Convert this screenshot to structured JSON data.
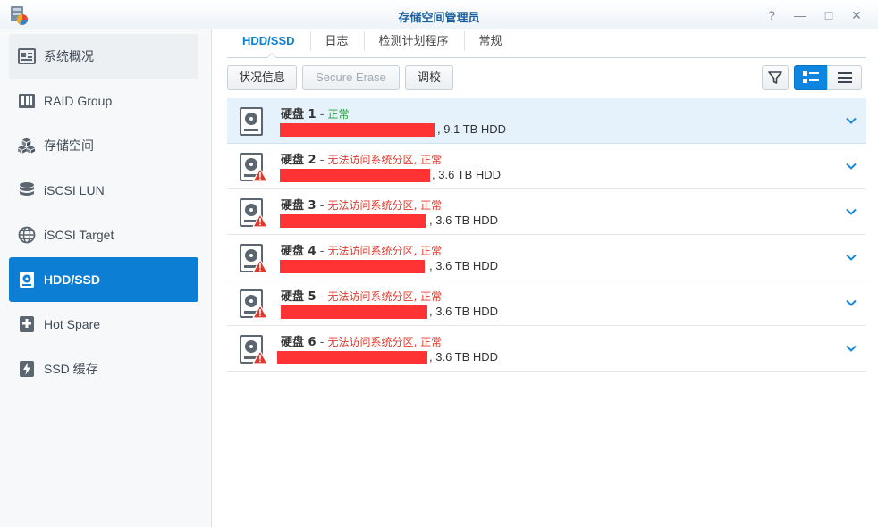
{
  "window": {
    "title": "存储空间管理员",
    "controls": [
      "?",
      "—",
      "□",
      "✕"
    ]
  },
  "sidebar": {
    "items": [
      {
        "label": "系统概况",
        "icon": "overview-icon"
      },
      {
        "label": "RAID Group",
        "icon": "raid-icon"
      },
      {
        "label": "存储空间",
        "icon": "cubes-icon"
      },
      {
        "label": "iSCSI LUN",
        "icon": "database-icon"
      },
      {
        "label": "iSCSI Target",
        "icon": "globe-icon"
      },
      {
        "label": "HDD/SSD",
        "icon": "disk-icon"
      },
      {
        "label": "Hot Spare",
        "icon": "hot-spare-icon"
      },
      {
        "label": "SSD 缓存",
        "icon": "ssd-cache-icon"
      }
    ],
    "active_index": 5
  },
  "tabs": [
    "HDD/SSD",
    "日志",
    "检测计划程序",
    "常规"
  ],
  "toolbar": {
    "status_label": "状况信息",
    "erase_label": "Secure Erase",
    "tune_label": "调校"
  },
  "disks": [
    {
      "name": "硬盘 1",
      "status": "正常",
      "status_type": "ok",
      "size": ", 9.1 TB HDD"
    },
    {
      "name": "硬盘 2",
      "status": "无法访问系统分区, 正常",
      "status_type": "warn",
      "size": ", 3.6 TB HDD"
    },
    {
      "name": "硬盘 3",
      "status": "无法访问系统分区, 正常",
      "status_type": "warn",
      "size": ", 3.6 TB HDD"
    },
    {
      "name": "硬盘 4",
      "status": "无法访问系统分区, 正常",
      "status_type": "warn",
      "size": ", 3.6 TB HDD"
    },
    {
      "name": "硬盘 5",
      "status": "无法访问系统分区, 正常",
      "status_type": "warn",
      "size": ", 3.6 TB HDD"
    },
    {
      "name": "硬盘 6",
      "status": "无法访问系统分区, 正常",
      "status_type": "warn",
      "size": ", 3.6 TB HDD"
    }
  ],
  "colors": {
    "accent": "#0c7fd5",
    "ok": "#26a13a",
    "warn": "#e0382c",
    "redaction": "#ff3333"
  }
}
